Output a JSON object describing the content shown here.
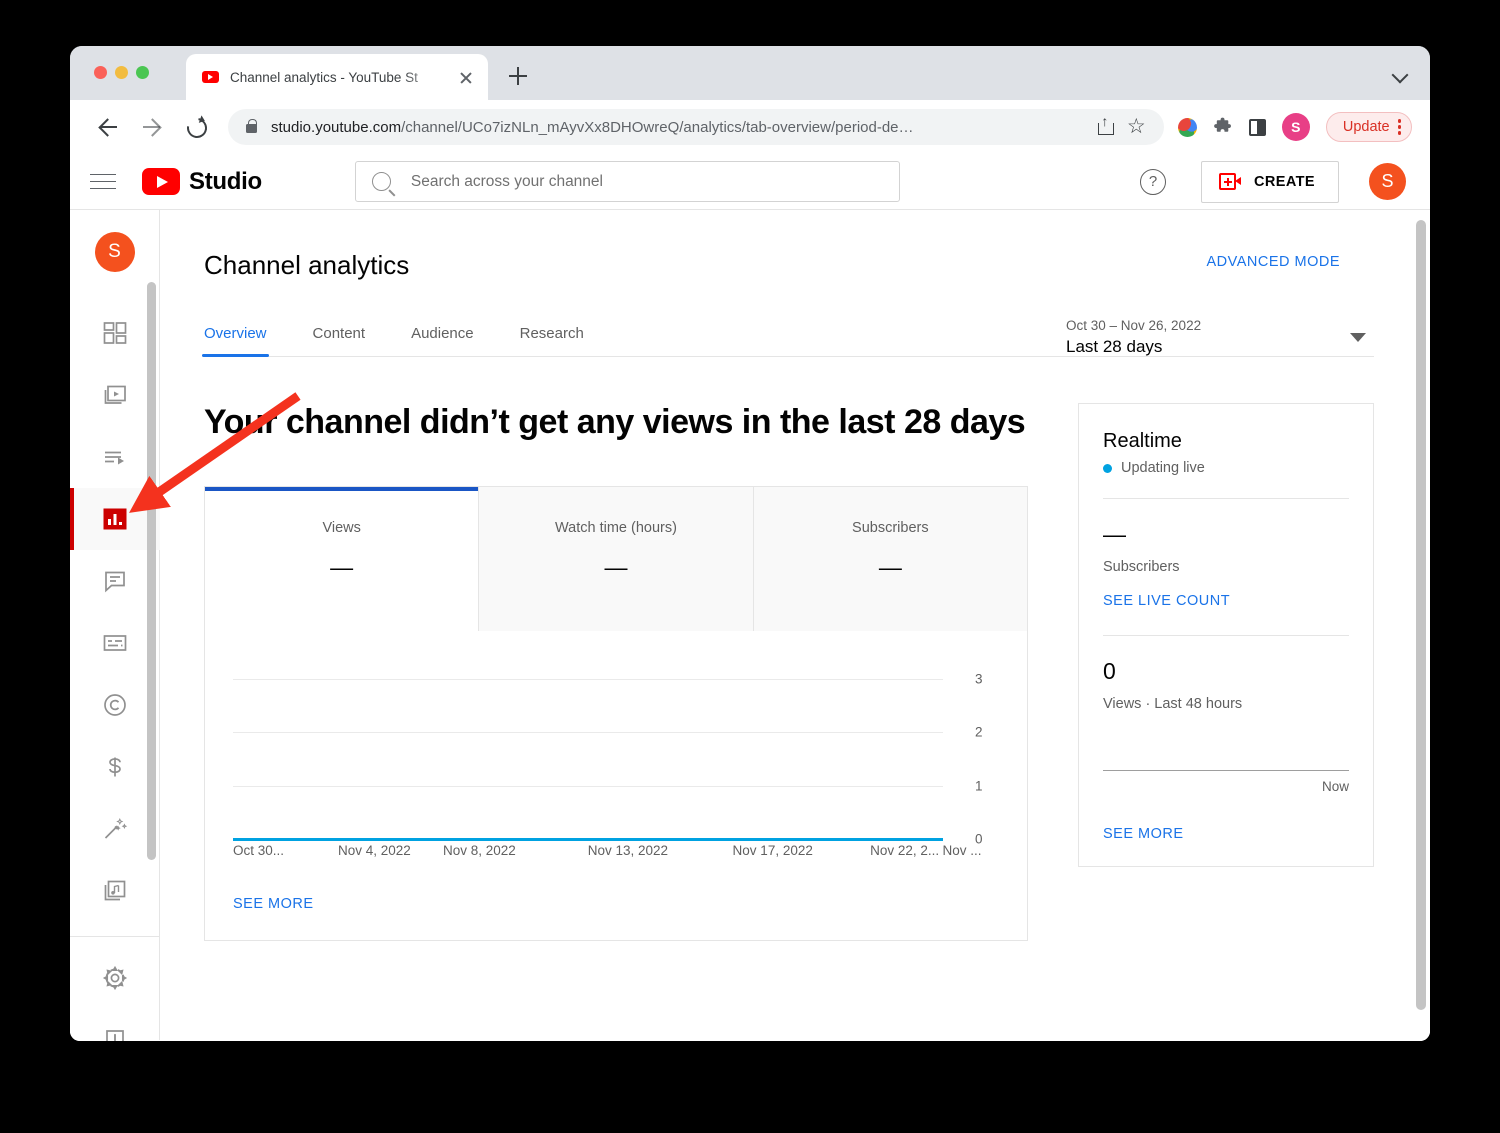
{
  "browser": {
    "tab_title": "Channel analytics - YouTube St",
    "url_host": "studio.youtube.com",
    "url_path": "/channel/UCo7izNLn_mAyvXx8DHOwreQ/analytics/tab-overview/period-de…",
    "update_label": "Update",
    "profile_initial": "S",
    "accent_update": "#d93025"
  },
  "masthead": {
    "logo_text": "Studio",
    "search_placeholder": "Search across your channel",
    "help_glyph": "?",
    "create_label": "CREATE",
    "avatar_initial": "S",
    "accent_red": "#ff0000"
  },
  "rail": {
    "avatar_initial": "S",
    "active_accent": "#cc0000",
    "items": [
      {
        "name": "dashboard",
        "label": "Dashboard"
      },
      {
        "name": "content",
        "label": "Content"
      },
      {
        "name": "playlists",
        "label": "Playlists"
      },
      {
        "name": "analytics",
        "label": "Analytics"
      },
      {
        "name": "comments",
        "label": "Comments"
      },
      {
        "name": "subtitles",
        "label": "Subtitles"
      },
      {
        "name": "copyright",
        "label": "Copyright"
      },
      {
        "name": "monetization",
        "label": "Earn"
      },
      {
        "name": "customisation",
        "label": "Customisation"
      },
      {
        "name": "audio-library",
        "label": "Audio library"
      }
    ],
    "footer_items": [
      {
        "name": "settings",
        "label": "Settings"
      },
      {
        "name": "send-feedback",
        "label": "Send feedback"
      }
    ]
  },
  "analytics": {
    "page_title": "Channel analytics",
    "advanced_mode": "ADVANCED MODE",
    "date_range_sub": "Oct 30 – Nov 26, 2022",
    "date_range_main": "Last 28 days",
    "tabs": [
      {
        "label": "Overview",
        "selected": true
      },
      {
        "label": "Content",
        "selected": false
      },
      {
        "label": "Audience",
        "selected": false
      },
      {
        "label": "Research",
        "selected": false
      }
    ],
    "headline": "Your channel didn’t get any views in the last 28 days",
    "metric_tabs": [
      {
        "label": "Views",
        "value": "—",
        "selected": true
      },
      {
        "label": "Watch time (hours)",
        "value": "—",
        "selected": false
      },
      {
        "label": "Subscribers",
        "value": "—",
        "selected": false
      }
    ],
    "see_more": "SEE MORE",
    "accent_blue": "#1a73e8",
    "accent_tab_blue": "#1a56c5"
  },
  "chart_data": {
    "type": "line",
    "title": "Views",
    "xlabel": "",
    "ylabel": "",
    "ylim": [
      0,
      3
    ],
    "yticks": [
      0,
      1,
      2,
      3
    ],
    "grid": true,
    "legend": false,
    "line_color": "#00a2e1",
    "x_tick_labels": [
      "Oct 30...",
      "Nov 4, 2022",
      "Nov 8, 2022",
      "Nov 13, 2022",
      "Nov 17, 2022",
      "Nov 22, 2...",
      "Nov ..."
    ],
    "x_tick_positions_pct": [
      0,
      14.5,
      29,
      49,
      69,
      88,
      98
    ],
    "series": [
      {
        "name": "Views",
        "values": [
          0,
          0,
          0,
          0,
          0,
          0,
          0,
          0,
          0,
          0,
          0,
          0,
          0,
          0,
          0,
          0,
          0,
          0,
          0,
          0,
          0,
          0,
          0,
          0,
          0,
          0,
          0,
          0
        ]
      }
    ]
  },
  "realtime": {
    "title": "Realtime",
    "live_status": "Updating live",
    "subs_value": "—",
    "subs_label": "Subscribers",
    "live_count_link": "SEE LIVE COUNT",
    "views_value": "0",
    "views_label": "Views · Last 48 hours",
    "axis_now": "Now",
    "see_more": "SEE MORE",
    "dot_color": "#00a2e1"
  },
  "annotation": {
    "arrow_color": "#f4321e"
  }
}
